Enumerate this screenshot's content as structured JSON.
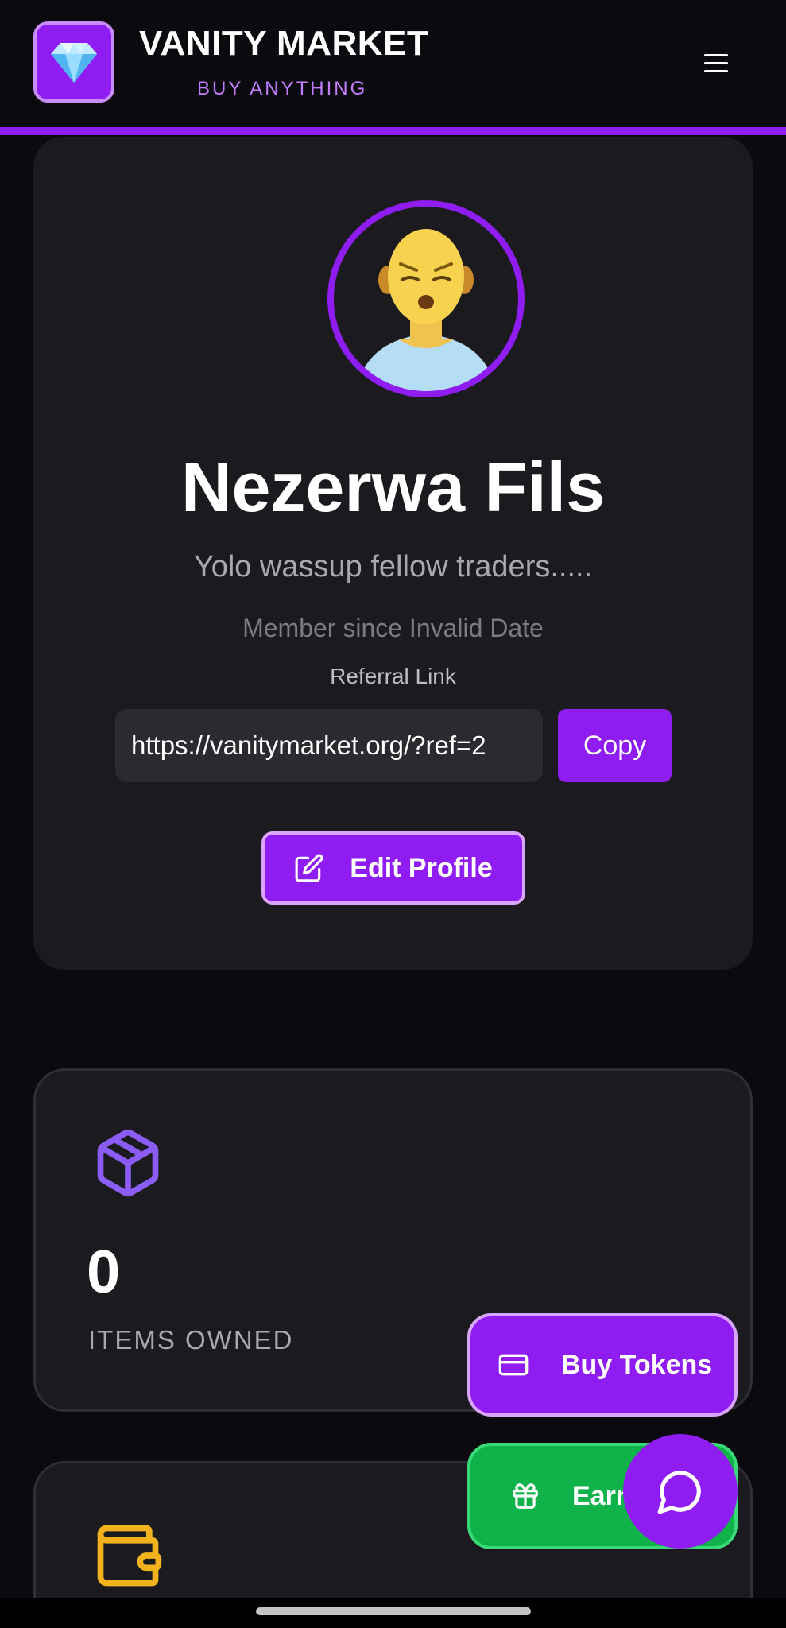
{
  "header": {
    "title": "VANITY MARKET",
    "subtitle": "BUY ANYTHING",
    "logo_icon": "diamond-icon",
    "menu_icon": "hamburger-menu-icon"
  },
  "profile": {
    "name": "Nezerwa Fils",
    "bio": "Yolo wassup fellow traders.....",
    "member_since": "Member since Invalid Date",
    "referral_label": "Referral Link",
    "referral_value": "https://vanitymarket.org/?ref=2",
    "copy_label": "Copy",
    "edit_label": "Edit Profile"
  },
  "stats": {
    "items": {
      "value": "0",
      "label": "ITEMS OWNED",
      "icon": "package-icon"
    },
    "wallet": {
      "icon": "wallet-icon"
    }
  },
  "floating": {
    "buy_tokens_label": "Buy Tokens",
    "earn_label": "Earn",
    "chat_icon": "chat-bubble-icon"
  },
  "colors": {
    "accent": "#8f1cf0",
    "background": "#0b0b0f",
    "card": "#1b1b1f",
    "earn_green": "#10b24a",
    "wallet_yellow": "#f2b21e",
    "package_purple": "#8b5cf6"
  }
}
